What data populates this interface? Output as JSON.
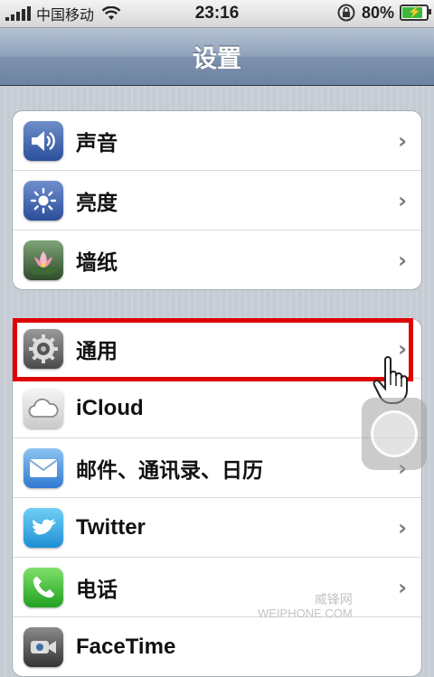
{
  "status_bar": {
    "carrier": "中国移动",
    "time": "23:16",
    "battery_percent": "80%",
    "battery_level": 0.8
  },
  "nav": {
    "title": "设置"
  },
  "groups": [
    {
      "rows": [
        {
          "label": "声音",
          "icon": "sound-icon"
        },
        {
          "label": "亮度",
          "icon": "brightness-icon"
        },
        {
          "label": "墙纸",
          "icon": "wallpaper-icon"
        }
      ]
    },
    {
      "rows": [
        {
          "label": "通用",
          "icon": "general-gear-icon"
        },
        {
          "label": "iCloud",
          "icon": "icloud-icon"
        },
        {
          "label": "邮件、通讯录、日历",
          "icon": "mail-icon"
        },
        {
          "label": "Twitter",
          "icon": "twitter-icon"
        },
        {
          "label": "电话",
          "icon": "phone-icon"
        },
        {
          "label": "FaceTime",
          "icon": "facetime-icon"
        }
      ]
    }
  ],
  "chevron": "›",
  "watermark": {
    "line1": "威锋网",
    "line2": "WEIPHONE.COM"
  },
  "colors": {
    "highlight": "#e00000",
    "nav": "#7d92ad"
  }
}
